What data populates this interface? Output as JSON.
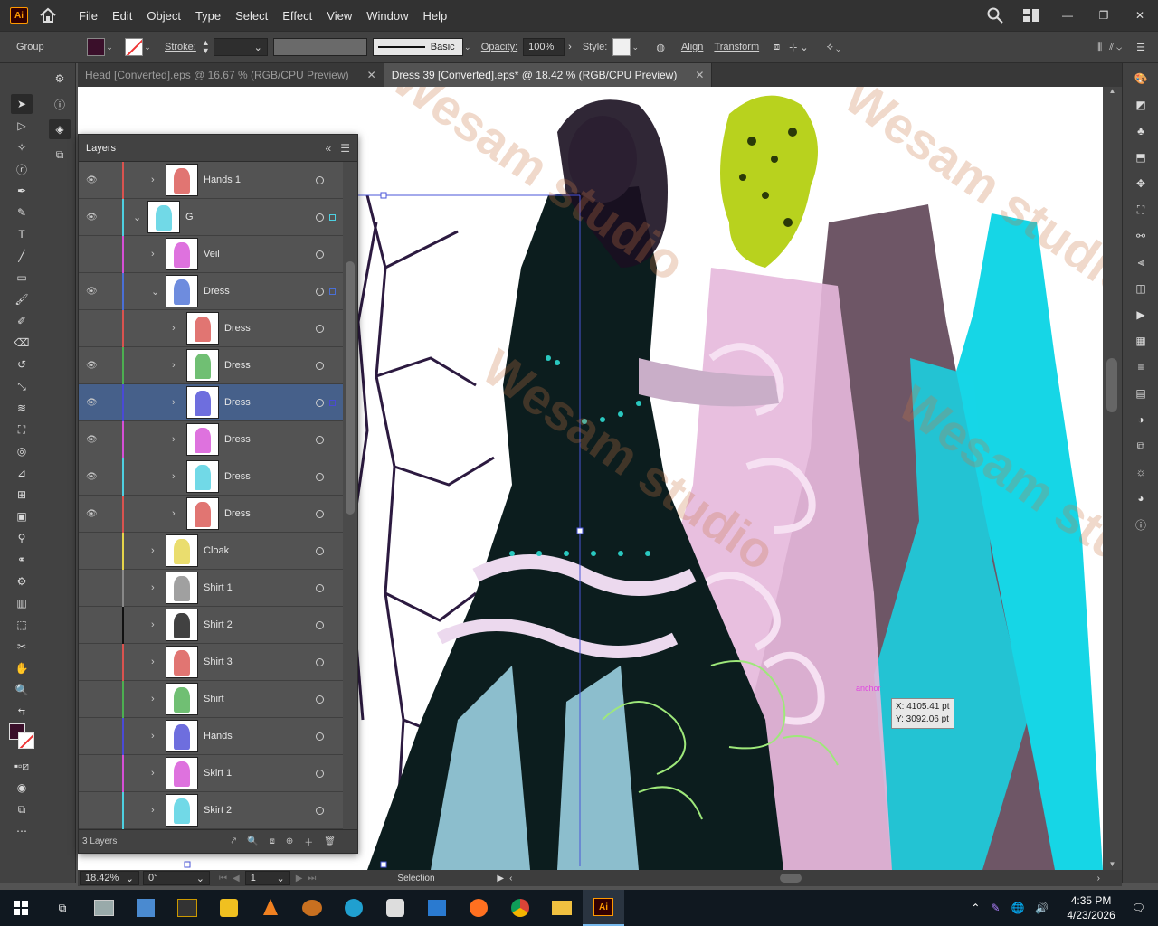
{
  "app": {
    "logo": "Ai",
    "menus": [
      "File",
      "Edit",
      "Object",
      "Type",
      "Select",
      "Effect",
      "View",
      "Window",
      "Help"
    ]
  },
  "control": {
    "selection_label": "Group",
    "stroke_label": "Stroke:",
    "brush_label": "Basic",
    "opacity_label": "Opacity:",
    "opacity_value": "100%",
    "style_label": "Style:",
    "align_label": "Align",
    "transform_label": "Transform",
    "fill_color": "#3a0f2a"
  },
  "tabs": [
    {
      "label": "Head [Converted].eps @ 16.67 % (RGB/CPU Preview)",
      "active": false
    },
    {
      "label": "Dress 39 [Converted].eps* @ 18.42 % (RGB/CPU Preview)",
      "active": true
    }
  ],
  "layers": {
    "title": "Layers",
    "count_label": "3 Layers",
    "rows": [
      {
        "name": "Hands 1",
        "color": "#d9534f",
        "visible": true,
        "indent": 0,
        "expanded": false,
        "selected": false
      },
      {
        "name": "G",
        "color": "#4dd0e1",
        "visible": true,
        "indent": -1,
        "expanded": true,
        "selected": false
      },
      {
        "name": "Veil",
        "color": "#d64fd6",
        "visible": false,
        "indent": 0,
        "expanded": false,
        "selected": false
      },
      {
        "name": "Dress",
        "color": "#4a6fd6",
        "visible": true,
        "indent": 0,
        "expanded": true,
        "selected": false
      },
      {
        "name": "Dress",
        "color": "#d9534f",
        "visible": false,
        "indent": 1,
        "expanded": false,
        "selected": false
      },
      {
        "name": "Dress",
        "color": "#4caf50",
        "visible": true,
        "indent": 1,
        "expanded": false,
        "selected": false
      },
      {
        "name": "Dress",
        "color": "#4a4ad6",
        "visible": true,
        "indent": 1,
        "expanded": false,
        "selected": true
      },
      {
        "name": "Dress",
        "color": "#d64fd6",
        "visible": true,
        "indent": 1,
        "expanded": false,
        "selected": false
      },
      {
        "name": "Dress",
        "color": "#4dd0e1",
        "visible": true,
        "indent": 1,
        "expanded": false,
        "selected": false
      },
      {
        "name": "Dress",
        "color": "#d9534f",
        "visible": true,
        "indent": 1,
        "expanded": false,
        "selected": false
      },
      {
        "name": "Cloak",
        "color": "#e5d44a",
        "visible": false,
        "indent": 0,
        "expanded": false,
        "selected": false
      },
      {
        "name": "Shirt 1",
        "color": "#888888",
        "visible": false,
        "indent": 0,
        "expanded": false,
        "selected": false
      },
      {
        "name": "Shirt 2",
        "color": "#111111",
        "visible": false,
        "indent": 0,
        "expanded": false,
        "selected": false
      },
      {
        "name": "Shirt 3",
        "color": "#d9534f",
        "visible": false,
        "indent": 0,
        "expanded": false,
        "selected": false
      },
      {
        "name": "Shirt",
        "color": "#4caf50",
        "visible": false,
        "indent": 0,
        "expanded": false,
        "selected": false
      },
      {
        "name": "Hands",
        "color": "#4a4ad6",
        "visible": false,
        "indent": 0,
        "expanded": false,
        "selected": false
      },
      {
        "name": "Skirt 1",
        "color": "#d64fd6",
        "visible": false,
        "indent": 0,
        "expanded": false,
        "selected": false
      },
      {
        "name": "Skirt 2",
        "color": "#4dd0e1",
        "visible": false,
        "indent": 0,
        "expanded": false,
        "selected": false
      }
    ]
  },
  "canvas": {
    "readout_x": "X: 4105.41 pt",
    "readout_y": "Y: 3092.06 pt",
    "anchor_label": "anchor",
    "watermark": "Wesam studio"
  },
  "status": {
    "zoom": "18.42%",
    "rotation": "0°",
    "artboard": "1",
    "tool": "Selection"
  },
  "taskbar": {
    "time": "4:35 PM",
    "date": "4/23/2026"
  }
}
